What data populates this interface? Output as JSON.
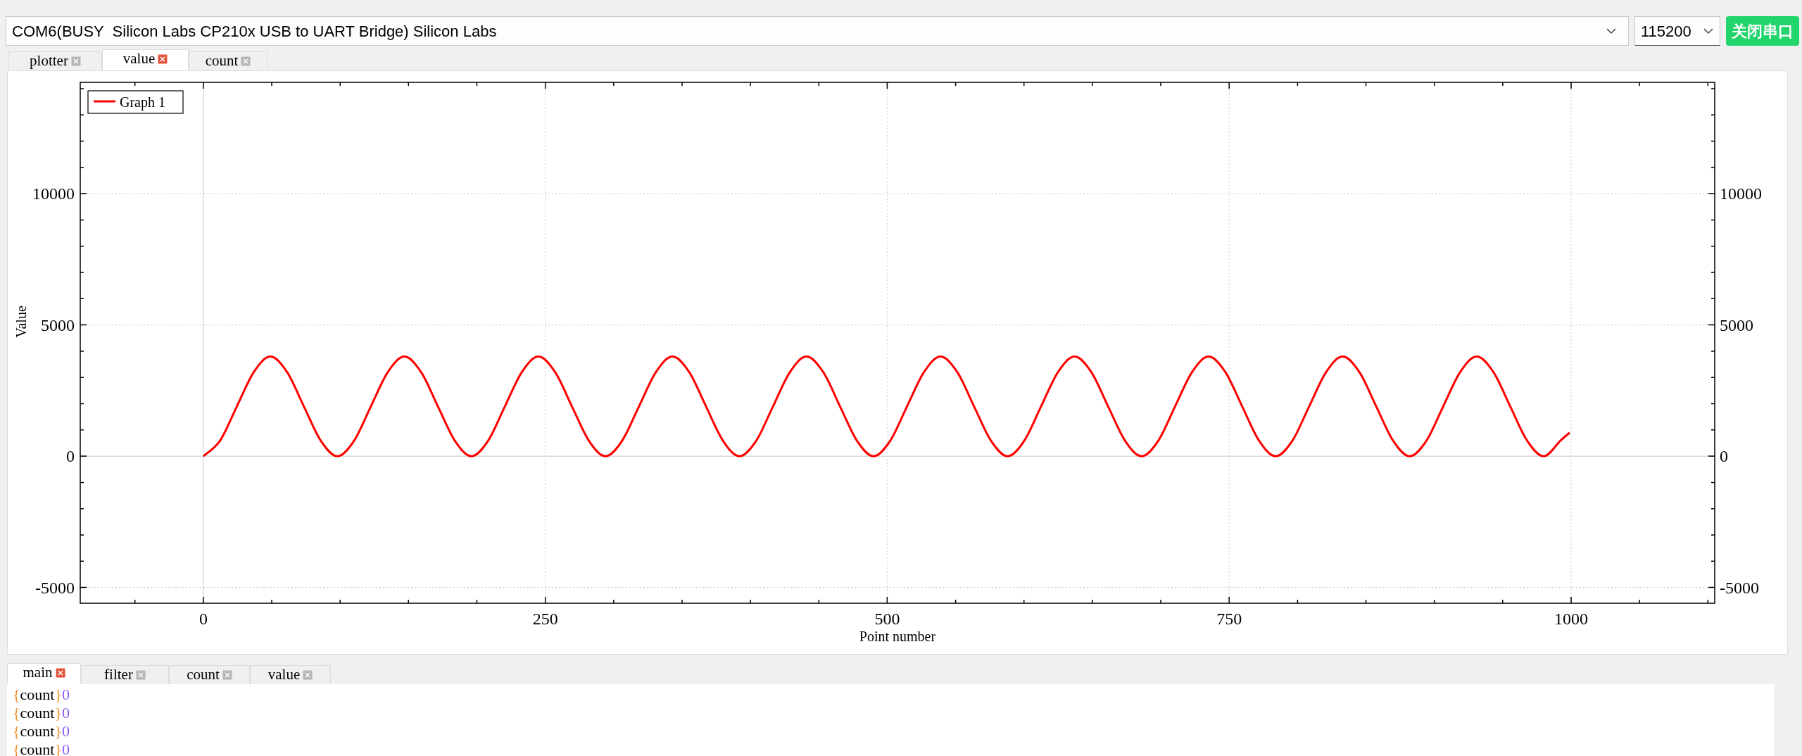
{
  "port_select": {
    "value": "COM6(BUSY  Silicon Labs CP210x USB to UART Bridge) Silicon Labs"
  },
  "baud_select": {
    "value": "115200"
  },
  "connect_button": {
    "label": "关闭串口"
  },
  "plot_tabs": [
    {
      "label": "plotter",
      "selected": false
    },
    {
      "label": "value",
      "selected": true
    },
    {
      "label": "count",
      "selected": false
    }
  ],
  "plot": {
    "chart_data": {
      "type": "line",
      "xlabel": "Point number",
      "ylabel": "Value",
      "x": [
        0,
        12.3,
        24.5,
        36.8,
        49,
        61.3,
        73.5,
        85.8,
        98,
        110.3,
        122.5,
        134.8,
        147,
        159.3,
        171.5,
        183.8,
        196,
        208.3,
        220.5,
        232.8,
        245,
        257.3,
        269.5,
        281.8,
        294,
        306.3,
        318.5,
        330.8,
        343,
        355.3,
        367.5,
        379.8,
        392,
        404.3,
        416.5,
        428.8,
        441,
        453.3,
        465.5,
        477.8,
        490,
        502.3,
        514.5,
        526.8,
        539,
        551.3,
        563.5,
        575.8,
        588,
        600.3,
        612.5,
        624.8,
        637,
        649.3,
        661.5,
        673.8,
        686,
        698.3,
        710.5,
        722.8,
        735,
        747.3,
        759.5,
        771.8,
        784,
        796.3,
        808.5,
        820.8,
        833,
        845.3,
        857.5,
        869.8,
        882,
        894.3,
        906.5,
        918.8,
        931,
        943.3,
        955.5,
        967.8,
        980,
        992.3,
        999
      ],
      "series": [
        {
          "name": "Graph 1",
          "color": "#ff0000",
          "values": [
            0,
            600,
            1900,
            3200,
            3800,
            3200,
            1900,
            600,
            0,
            600,
            1900,
            3200,
            3800,
            3200,
            1900,
            600,
            0,
            600,
            1900,
            3200,
            3800,
            3200,
            1900,
            600,
            0,
            600,
            1900,
            3200,
            3800,
            3200,
            1900,
            600,
            0,
            600,
            1900,
            3200,
            3800,
            3200,
            1900,
            600,
            0,
            600,
            1900,
            3200,
            3800,
            3200,
            1900,
            600,
            0,
            600,
            1900,
            3200,
            3800,
            3200,
            1900,
            600,
            0,
            600,
            1900,
            3200,
            3800,
            3200,
            1900,
            600,
            0,
            600,
            1900,
            3200,
            3800,
            3200,
            1900,
            600,
            0,
            600,
            1900,
            3200,
            3800,
            3200,
            1900,
            600,
            0,
            600,
            900
          ]
        }
      ],
      "xlim": [
        -90,
        1105
      ],
      "ylim": [
        -5600,
        14240
      ],
      "xticks": [
        0,
        250,
        500,
        750,
        1000
      ],
      "yticks": [
        {
          "value": -5000,
          "label": "-5000"
        },
        {
          "value": 0,
          "label": "0"
        },
        {
          "value": 5000,
          "label": "5000"
        },
        {
          "value": 10000,
          "label": "10000"
        }
      ],
      "y2ticks": [
        {
          "value": -5000,
          "label": "-5000"
        },
        {
          "value": 0,
          "label": "0"
        },
        {
          "value": 5000,
          "label": "5000"
        },
        {
          "value": 10000,
          "label": "10000"
        }
      ],
      "y2lim": [
        -5600,
        14240
      ],
      "grid": true
    }
  },
  "console_tabs": [
    {
      "label": "main",
      "selected": true
    },
    {
      "label": "filter",
      "selected": false
    },
    {
      "label": "count",
      "selected": false
    },
    {
      "label": "value",
      "selected": false
    }
  ],
  "console_lines": [
    {
      "key": "{count}",
      "value": "0"
    },
    {
      "key": "{count}",
      "value": "0"
    },
    {
      "key": "{count}",
      "value": "0"
    },
    {
      "key": "{count}",
      "value": "0"
    }
  ]
}
